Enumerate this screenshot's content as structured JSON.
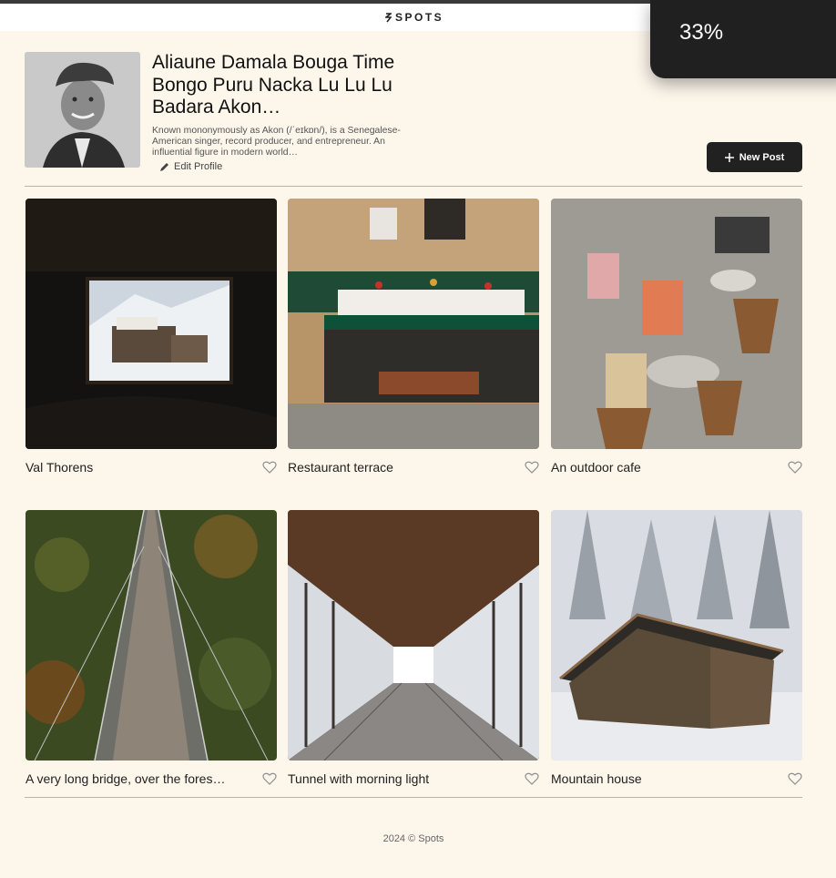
{
  "header": {
    "logo_text": "SPOTS"
  },
  "progress": {
    "label": "33%"
  },
  "profile": {
    "name": "Aliaune Damala Bouga Time Bongo Puru Nacka Lu Lu Lu Badara Akon…",
    "bio": "Known mononymously as Akon (/ˈeɪkɒn/), is a Senegalese-American singer, record producer, and entrepreneur. An influential figure in modern world…",
    "edit_label": "Edit Profile"
  },
  "actions": {
    "new_post_label": "New Post"
  },
  "cards": [
    {
      "title": "Val Thorens"
    },
    {
      "title": "Restaurant terrace"
    },
    {
      "title": "An outdoor cafe"
    },
    {
      "title": "A very long bridge, over the fores…"
    },
    {
      "title": "Tunnel with morning light"
    },
    {
      "title": "Mountain house"
    }
  ],
  "footer": {
    "text": "2024 © Spots"
  },
  "colors": {
    "background": "#fdf6eb",
    "button": "#212121",
    "progress_bg": "#202020"
  },
  "icons": [
    "spots-logo-icon",
    "pencil-icon",
    "plus-icon",
    "heart-icon"
  ]
}
